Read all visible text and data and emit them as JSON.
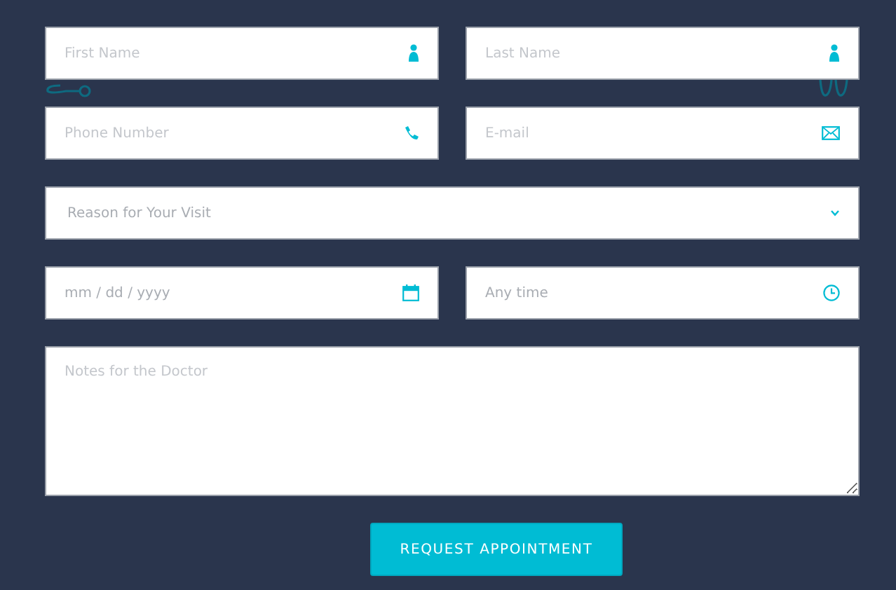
{
  "rows": [
    {
      "fields": [
        {
          "kind": "name",
          "placeholder": "First Name"
        },
        {
          "kind": "name",
          "placeholder": "Last Name"
        }
      ]
    },
    {
      "fields": [
        {
          "kind": "phone",
          "placeholder": "Phone Number"
        },
        {
          "kind": "email",
          "placeholder": "E-mail"
        }
      ]
    },
    {
      "fields": [
        {
          "kind": "select",
          "placeholder": "Reason for Your Visit"
        }
      ]
    },
    {
      "fields": [
        {
          "kind": "date",
          "placeholder": "mm / dd / yyyy"
        },
        {
          "kind": "time",
          "placeholder": "Any time"
        }
      ]
    },
    {
      "fields": [
        {
          "kind": "notes",
          "placeholder": "Notes for the Doctor"
        }
      ]
    }
  ],
  "submit": {
    "label": "REQUEST APPOINTMENT"
  }
}
